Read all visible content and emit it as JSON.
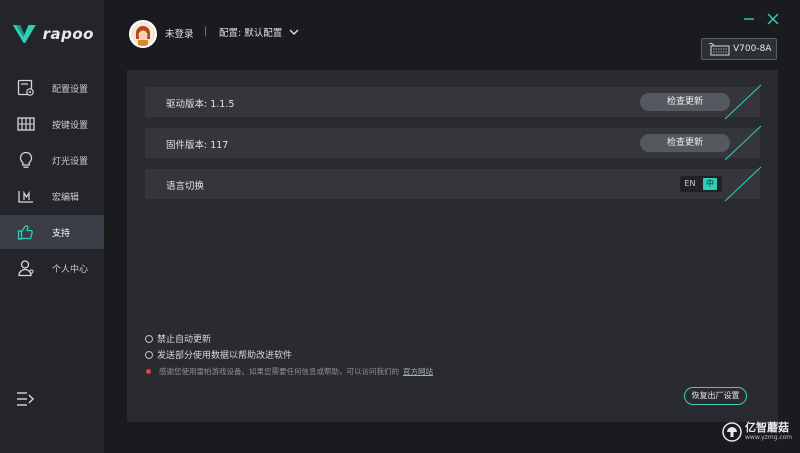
{
  "brand": {
    "name": "rapoo",
    "accent": "#2ecfb8"
  },
  "sidebar": {
    "items": [
      {
        "label": "配置设置",
        "icon": "profile-settings-icon"
      },
      {
        "label": "按键设置",
        "icon": "keyboard-keys-icon"
      },
      {
        "label": "灯光设置",
        "icon": "lightbulb-icon"
      },
      {
        "label": "宏编辑",
        "icon": "macro-icon"
      },
      {
        "label": "支持",
        "icon": "thumbs-up-icon",
        "active": true
      },
      {
        "label": "个人中心",
        "icon": "user-icon"
      }
    ],
    "menu_icon": "menu-collapse-icon"
  },
  "header": {
    "login_status": "未登录",
    "separator": "|",
    "config_label": "配置: 默认配置",
    "device_name": "V700-8A"
  },
  "support": {
    "driver_version": "驱动版本: 1.1.5",
    "firmware_version": "固件版本: 117",
    "check_update_label": "检查更新",
    "language_label": "语言切换",
    "lang_en": "EN",
    "lang_zh": "中",
    "lang_selected": "中"
  },
  "options": {
    "disable_auto_update": "禁止自动更新",
    "send_usage_data": "发送部分使用数据以帮助改进软件"
  },
  "notice": {
    "text": "感谢您使用雷柏游戏设备。如果您需要任何信息或帮助，可以访问我们的",
    "link": "官方网站"
  },
  "reset_label": "恢复出厂设置",
  "watermark": {
    "cn": "亿智蘑菇",
    "url": "www.yzmg.com"
  }
}
